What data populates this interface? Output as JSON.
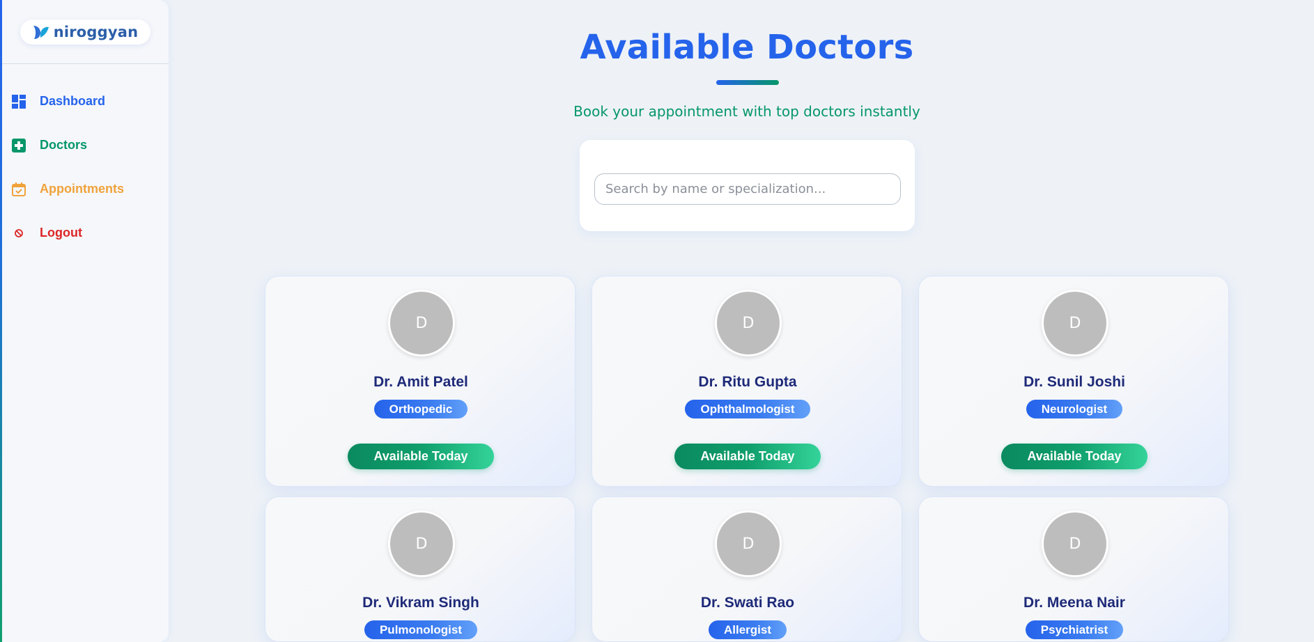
{
  "brand": {
    "name": "niroggyan"
  },
  "sidebar": {
    "items": [
      {
        "label": "Dashboard",
        "icon": "dashboard-icon"
      },
      {
        "label": "Doctors",
        "icon": "medical-cross-icon"
      },
      {
        "label": "Appointments",
        "icon": "calendar-check-icon"
      },
      {
        "label": "Logout",
        "icon": "logout-icon"
      }
    ]
  },
  "colors": {
    "primary": "#2563eb",
    "secondary": "#059669",
    "appointments": "#f0a23a",
    "logout": "#dc2626",
    "doctor_name": "#1e2a78"
  },
  "page": {
    "title": "Available Doctors",
    "subtitle": "Book your appointment with top doctors instantly"
  },
  "search": {
    "placeholder": "Search by name or specialization...",
    "value": ""
  },
  "doctors": [
    {
      "initial": "D",
      "name": "Dr. Amit Patel",
      "specialization": "Orthopedic",
      "availability": "Available Today"
    },
    {
      "initial": "D",
      "name": "Dr. Ritu Gupta",
      "specialization": "Ophthalmologist",
      "availability": "Available Today"
    },
    {
      "initial": "D",
      "name": "Dr. Sunil Joshi",
      "specialization": "Neurologist",
      "availability": "Available Today"
    },
    {
      "initial": "D",
      "name": "Dr. Vikram Singh",
      "specialization": "Pulmonologist",
      "availability": ""
    },
    {
      "initial": "D",
      "name": "Dr. Swati Rao",
      "specialization": "Allergist",
      "availability": ""
    },
    {
      "initial": "D",
      "name": "Dr. Meena Nair",
      "specialization": "Psychiatrist",
      "availability": ""
    }
  ]
}
